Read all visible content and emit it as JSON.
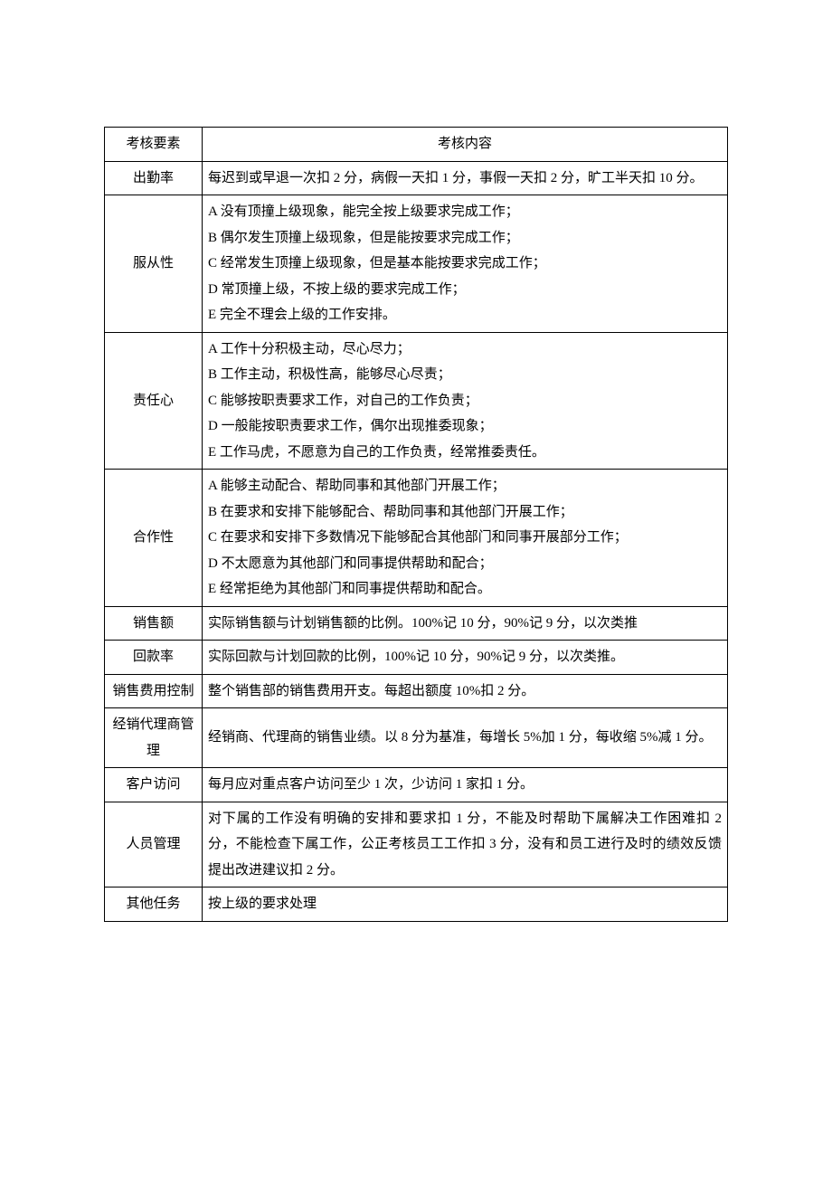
{
  "header": {
    "col1": "考核要素",
    "col2": "考核内容"
  },
  "rows": [
    {
      "label": "出勤率",
      "content": [
        "每迟到或早退一次扣 2 分，病假一天扣 1 分，事假一天扣 2 分，旷工半天扣 10 分。"
      ]
    },
    {
      "label": "服从性",
      "content": [
        "A 没有顶撞上级现象，能完全按上级要求完成工作；",
        "B 偶尔发生顶撞上级现象，但是能按要求完成工作；",
        "C 经常发生顶撞上级现象，但是基本能按要求完成工作；",
        "D 常顶撞上级，不按上级的要求完成工作；",
        "E 完全不理会上级的工作安排。"
      ]
    },
    {
      "label": "责任心",
      "content": [
        "A 工作十分积极主动，尽心尽力；",
        "B 工作主动，积极性高，能够尽心尽责；",
        "C 能够按职责要求工作，对自己的工作负责；",
        "D 一般能按职责要求工作，偶尔出现推委现象；",
        "E 工作马虎，不愿意为自己的工作负责，经常推委责任。"
      ]
    },
    {
      "label": "合作性",
      "content": [
        "A 能够主动配合、帮助同事和其他部门开展工作；",
        "B 在要求和安排下能够配合、帮助同事和其他部门开展工作；",
        "C 在要求和安排下多数情况下能够配合其他部门和同事开展部分工作；",
        "D 不太愿意为其他部门和同事提供帮助和配合；",
        "E 经常拒绝为其他部门和同事提供帮助和配合。"
      ]
    },
    {
      "label": "销售额",
      "content": [
        "实际销售额与计划销售额的比例。100%记 10 分，90%记 9 分，以次类推"
      ]
    },
    {
      "label": "回款率",
      "content": [
        "实际回款与计划回款的比例，100%记 10 分，90%记 9 分，以次类推。"
      ]
    },
    {
      "label": "销售费用控制",
      "content": [
        "整个销售部的销售费用开支。每超出额度 10%扣 2 分。"
      ]
    },
    {
      "label": "经销代理商管理",
      "content": [
        "经销商、代理商的销售业绩。以 8 分为基准，每增长 5%加 1 分，每收缩 5%减 1 分。"
      ]
    },
    {
      "label": "客户访问",
      "content": [
        "每月应对重点客户访问至少 1 次，少访问 1 家扣 1 分。"
      ]
    },
    {
      "label": "人员管理",
      "content": [
        "对下属的工作没有明确的安排和要求扣 1 分，不能及时帮助下属解决工作困难扣 2 分，不能检查下属工作，公正考核员工工作扣 3 分，没有和员工进行及时的绩效反馈提出改进建议扣 2 分。"
      ]
    },
    {
      "label": "其他任务",
      "content": [
        "按上级的要求处理"
      ]
    }
  ]
}
